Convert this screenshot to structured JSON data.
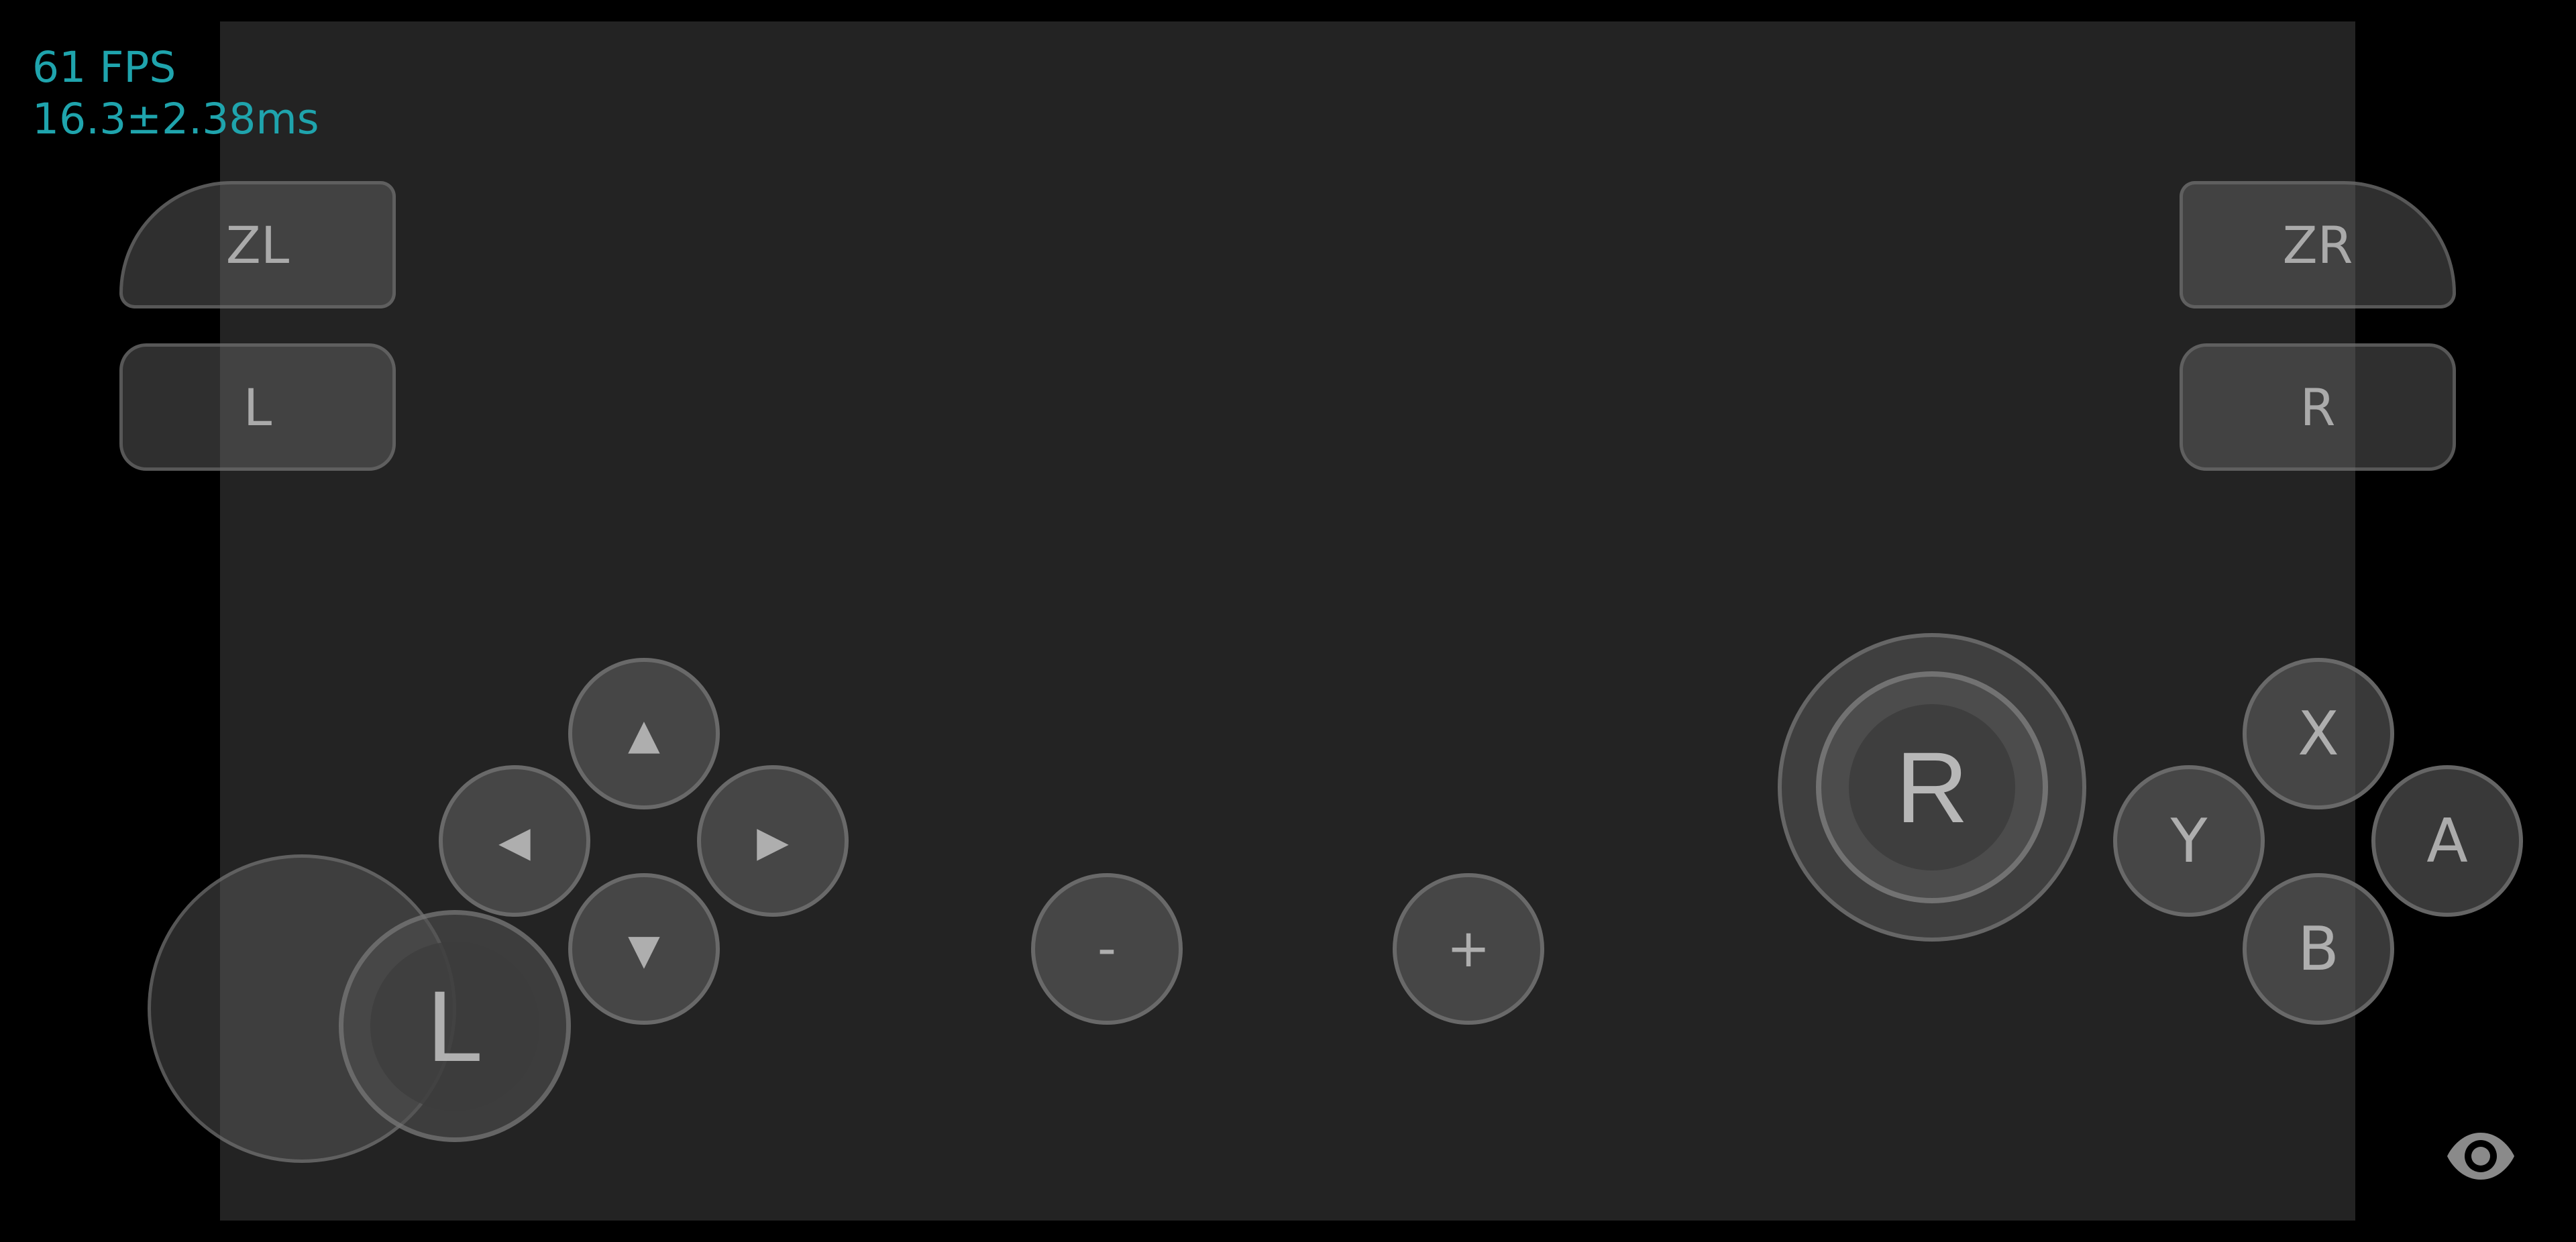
{
  "stats": {
    "fps": "61 FPS",
    "frametime": "16.3±2.38ms"
  },
  "shoulders": {
    "zl": "ZL",
    "l": "L",
    "zr": "ZR",
    "r": "R"
  },
  "dpad": {
    "up": "▲",
    "down": "▼",
    "left": "◀",
    "right": "▶"
  },
  "system": {
    "minus": "-",
    "plus": "+"
  },
  "face": {
    "x": "X",
    "y": "Y",
    "a": "A",
    "b": "B"
  },
  "sticks": {
    "left": "L",
    "right": "R"
  },
  "icons": {
    "overlay_toggle": "eye-icon"
  }
}
